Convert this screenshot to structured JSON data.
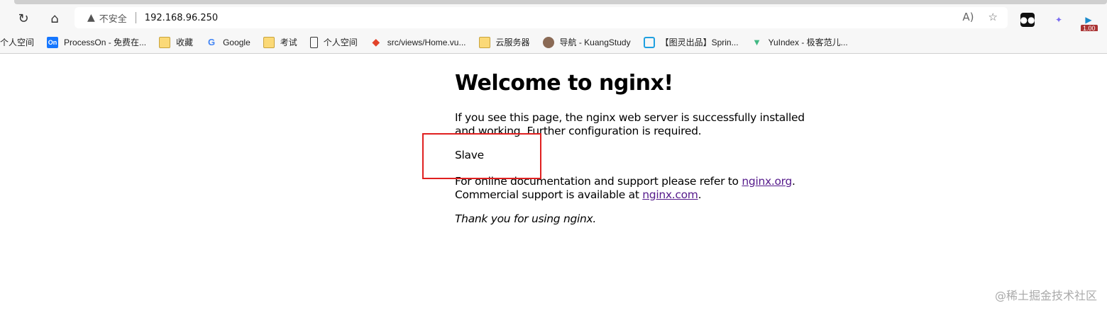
{
  "browser": {
    "security_label": "不安全",
    "url": "192.168.96.250",
    "extension_badge": "1.00",
    "bookmarks": [
      {
        "label": "个人空间",
        "icon": "none"
      },
      {
        "label": "ProcessOn - 免费在...",
        "icon": "processon-icon"
      },
      {
        "label": "收藏",
        "icon": "folder-icon"
      },
      {
        "label": "Google",
        "icon": "google-icon"
      },
      {
        "label": "考试",
        "icon": "folder-icon"
      },
      {
        "label": "个人空间",
        "icon": "page-icon"
      },
      {
        "label": "src/views/Home.vu...",
        "icon": "gitlab-icon"
      },
      {
        "label": "云服务器",
        "icon": "folder-icon"
      },
      {
        "label": "导航 - KuangStudy",
        "icon": "avatar-icon"
      },
      {
        "label": "【图灵出品】Sprin...",
        "icon": "bilibili-icon"
      },
      {
        "label": "YuIndex - 极客范儿...",
        "icon": "vue-icon"
      }
    ]
  },
  "page": {
    "title": "Welcome to nginx!",
    "intro": "If you see this page, the nginx web server is successfully installed and working. Further configuration is required.",
    "marker": "Slave",
    "docs_prefix": "For online documentation and support please refer to ",
    "docs_link": "nginx.org",
    "docs_suffix": ".",
    "commercial_prefix": "Commercial support is available at ",
    "commercial_link": "nginx.com",
    "commercial_suffix": ".",
    "thanks": "Thank you for using nginx."
  },
  "watermark": "@稀土掘金技术社区"
}
